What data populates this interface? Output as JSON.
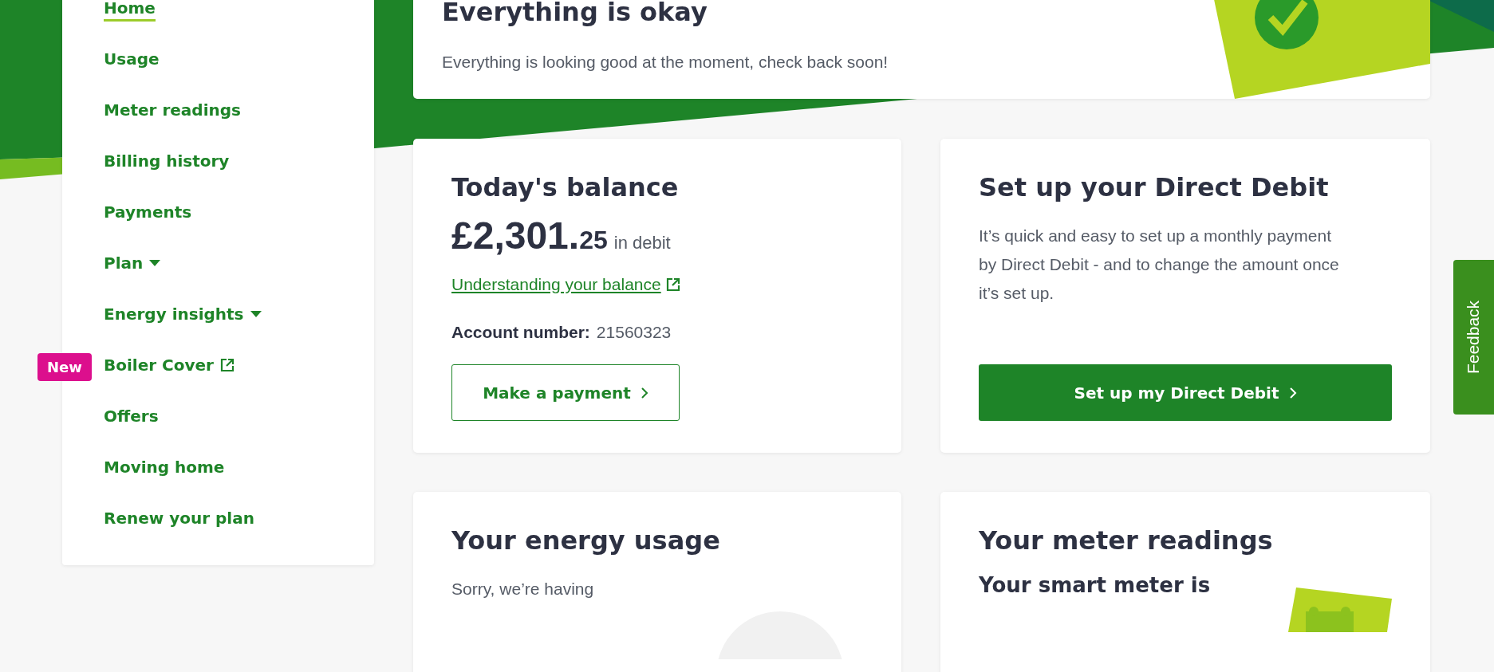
{
  "sidebar": {
    "items": [
      {
        "label": "Home",
        "selected": true,
        "kind": "link"
      },
      {
        "label": "Usage",
        "selected": false,
        "kind": "link"
      },
      {
        "label": "Meter readings",
        "selected": false,
        "kind": "link"
      },
      {
        "label": "Billing history",
        "selected": false,
        "kind": "link"
      },
      {
        "label": "Payments",
        "selected": false,
        "kind": "link"
      },
      {
        "label": "Plan",
        "selected": false,
        "kind": "dropdown"
      },
      {
        "label": "Energy insights",
        "selected": false,
        "kind": "dropdown"
      },
      {
        "label": "Boiler Cover",
        "selected": false,
        "kind": "external",
        "badge": "New"
      },
      {
        "label": "Offers",
        "selected": false,
        "kind": "link"
      },
      {
        "label": "Moving home",
        "selected": false,
        "kind": "link"
      },
      {
        "label": "Renew your plan",
        "selected": false,
        "kind": "link"
      }
    ]
  },
  "status_card": {
    "title": "Everything is okay",
    "message": "Everything is looking good at the moment, check back soon!"
  },
  "balance_card": {
    "title": "Today's balance",
    "amount_main": "£2,301.",
    "amount_pence": "25",
    "amount_note": "in debit",
    "link": "Understanding your balance",
    "account_label": "Account number:",
    "account_number": "21560323",
    "button": "Make a payment"
  },
  "direct_debit_card": {
    "title": "Set up your Direct Debit",
    "text": "It’s quick and easy to set up a monthly payment by Direct Debit - and to change the amount once it’s set up.",
    "button": "Set up my Direct Debit"
  },
  "usage_card": {
    "title": "Your energy usage",
    "text": "Sorry, we’re having"
  },
  "meter_card": {
    "title": "Your meter readings",
    "subtitle": "Your smart meter is"
  },
  "feedback_tab": {
    "label": "Feedback"
  }
}
